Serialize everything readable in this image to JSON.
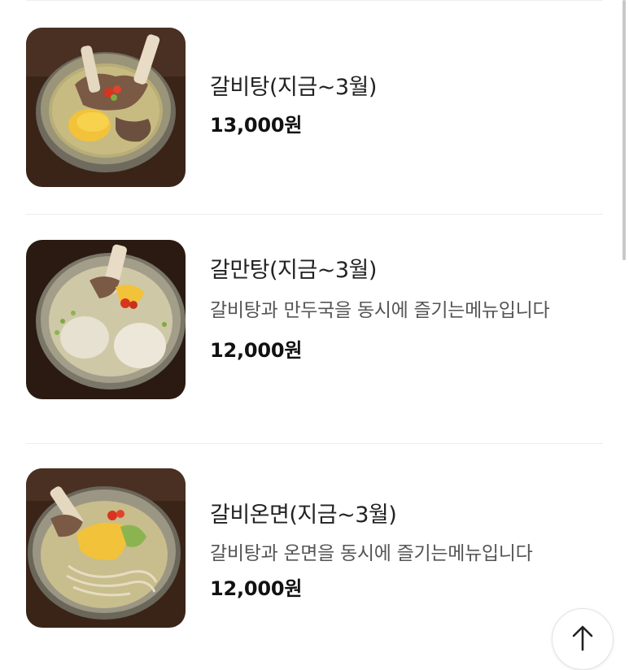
{
  "menu": {
    "items": [
      {
        "name": "갈비탕(지금~3월)",
        "description": "",
        "price": "13,000원",
        "image_icon": "galbitang-photo"
      },
      {
        "name": "갈만탕(지금~3월)",
        "description": "갈비탕과 만두국을 동시에 즐기는메뉴입니다",
        "price": "12,000원",
        "image_icon": "galmantang-photo"
      },
      {
        "name": "갈비온면(지금~3월)",
        "description": "갈비탕과 온면을 동시에 즐기는메뉴입니다",
        "price": "12,000원",
        "image_icon": "galbi-onmyeon-photo"
      }
    ]
  },
  "scroll_top_button": {
    "icon": "arrow-up-icon"
  },
  "colors": {
    "background": "#ffffff",
    "divider": "#ececec",
    "text_primary": "#222222",
    "text_secondary": "#555555"
  }
}
